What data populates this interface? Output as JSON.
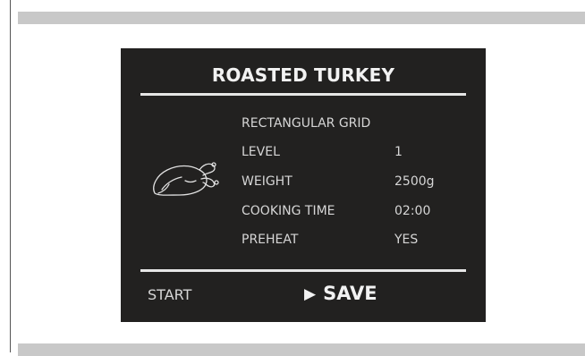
{
  "recipe": {
    "title": "ROASTED TURKEY"
  },
  "details": {
    "grid": "RECTANGULAR GRID",
    "rows": [
      {
        "label": "LEVEL",
        "value": "1"
      },
      {
        "label": "WEIGHT",
        "value": "2500g"
      },
      {
        "label": "COOKING TIME",
        "value": "02:00"
      },
      {
        "label": "PREHEAT",
        "value": "YES"
      }
    ]
  },
  "footer": {
    "start_label": "START",
    "save_label": "SAVE",
    "save_icon": "play-icon"
  },
  "icons": {
    "dish": "turkey-icon"
  },
  "colors": {
    "panel_bg": "#222120",
    "text": "#d6d6d6",
    "rule": "#e6e6e6",
    "bars": "#c8c8c8"
  }
}
